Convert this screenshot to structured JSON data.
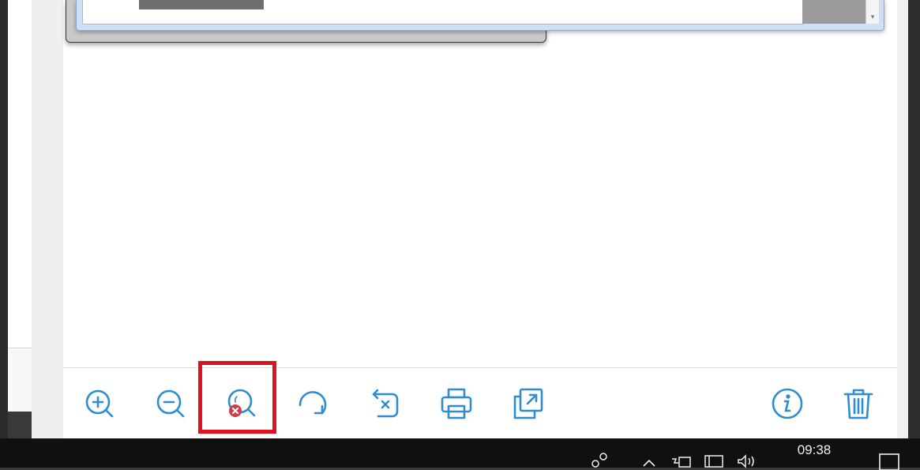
{
  "toolbar": {
    "buttons": [
      {
        "name": "zoom-in",
        "icon": "zoom-in-icon"
      },
      {
        "name": "zoom-out",
        "icon": "zoom-out-icon"
      },
      {
        "name": "zoom-reset",
        "icon": "zoom-reset-icon"
      },
      {
        "name": "rotate",
        "icon": "rotate-clockwise-icon"
      },
      {
        "name": "undo-rotate",
        "icon": "undo-icon"
      },
      {
        "name": "print",
        "icon": "printer-icon"
      },
      {
        "name": "open-external",
        "icon": "external-open-icon"
      },
      {
        "name": "info",
        "icon": "info-icon"
      },
      {
        "name": "delete",
        "icon": "trash-icon"
      }
    ],
    "accent_color": "#2e8ccf",
    "highlight_color": "#e0121f",
    "highlighted_button": "zoom-reset"
  },
  "taskbar": {
    "clock": "09:38",
    "tray_icons": [
      "people-icon",
      "chevron-up-icon",
      "power-icon",
      "network-icon",
      "volume-icon",
      "notification-icon"
    ]
  }
}
